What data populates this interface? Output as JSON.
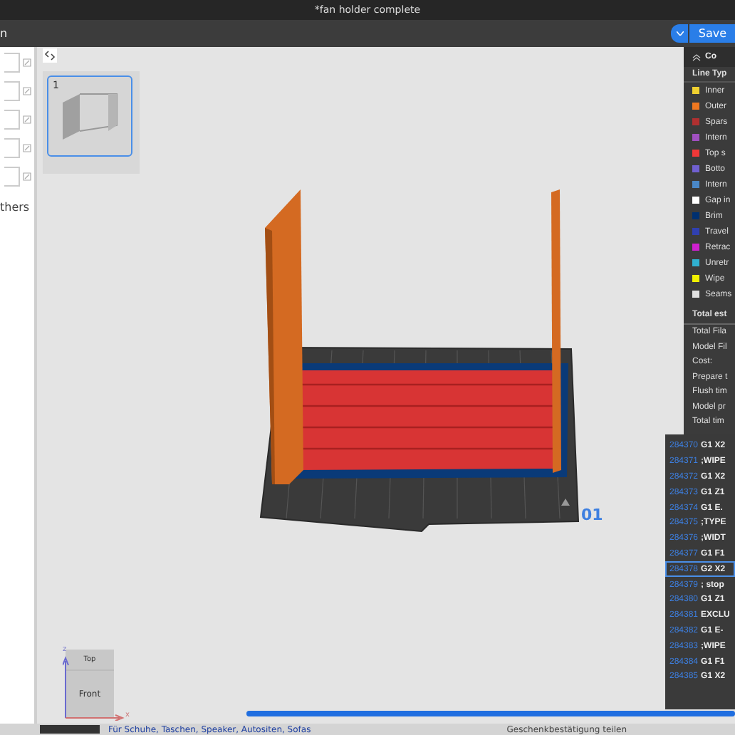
{
  "window": {
    "title": "*fan holder complete"
  },
  "toolbar": {
    "left_text": "n",
    "save_label": "Save"
  },
  "left_panel": {
    "tab_text": "thers"
  },
  "plate": {
    "thumbnail_number": "1",
    "plate_number": "01"
  },
  "legend": {
    "header": "Co",
    "section": "Line Typ",
    "items": [
      {
        "label": "Inner",
        "color": "#f0d030"
      },
      {
        "label": "Outer",
        "color": "#f07820"
      },
      {
        "label": "Spars",
        "color": "#b03030"
      },
      {
        "label": "Intern",
        "color": "#a050c0"
      },
      {
        "label": "Top s",
        "color": "#f03838"
      },
      {
        "label": "Botto",
        "color": "#7060d0"
      },
      {
        "label": "Intern",
        "color": "#4a88c8"
      },
      {
        "label": "Gap in",
        "color": "#ffffff"
      },
      {
        "label": "Brim",
        "color": "#003070"
      },
      {
        "label": "Travel",
        "color": "#3040b0"
      },
      {
        "label": "Retrac",
        "color": "#d020d0"
      },
      {
        "label": "Unretr",
        "color": "#30b0d0"
      },
      {
        "label": "Wipe",
        "color": "#f0f000"
      },
      {
        "label": "Seams",
        "color": "#e0e0e0"
      }
    ],
    "totals_header": "Total est",
    "totals": [
      "Total Fila",
      "Model Fil",
      "Cost:",
      "Prepare t",
      "Flush tim",
      "Model pr",
      "Total tim"
    ]
  },
  "gcode": {
    "lines": [
      {
        "number": "284370",
        "code": "G1 X2",
        "selected": false
      },
      {
        "number": "284371",
        "code": ";WIPE",
        "selected": false
      },
      {
        "number": "284372",
        "code": "G1 X2",
        "selected": false
      },
      {
        "number": "284373",
        "code": "G1 Z1",
        "selected": false
      },
      {
        "number": "284374",
        "code": "G1 E.",
        "selected": false
      },
      {
        "number": "284375",
        "code": ";TYPE",
        "selected": false
      },
      {
        "number": "284376",
        "code": ";WIDT",
        "selected": false
      },
      {
        "number": "284377",
        "code": "G1 F1",
        "selected": false
      },
      {
        "number": "284378",
        "code": "G2 X2",
        "selected": true
      },
      {
        "number": "284379",
        "code": "; stop",
        "selected": false
      },
      {
        "number": "284380",
        "code": "G1 Z1",
        "selected": false
      },
      {
        "number": "284381",
        "code": "EXCLU",
        "selected": false
      },
      {
        "number": "284382",
        "code": "G1 E-",
        "selected": false
      },
      {
        "number": "284383",
        "code": ";WIPE",
        "selected": false
      },
      {
        "number": "284384",
        "code": "G1 F1",
        "selected": false
      },
      {
        "number": "284385",
        "code": "G1 X2",
        "selected": false
      }
    ]
  },
  "view_cube": {
    "top": "Top",
    "front": "Front",
    "x_axis": "x",
    "z_axis": "z"
  },
  "layer_slider": {
    "level": 1
  },
  "taskbar": {
    "items": [
      "Für Schuhe, Taschen, Speaker, Autositen, Sofas",
      "Geschenkbestätigung teilen"
    ]
  }
}
